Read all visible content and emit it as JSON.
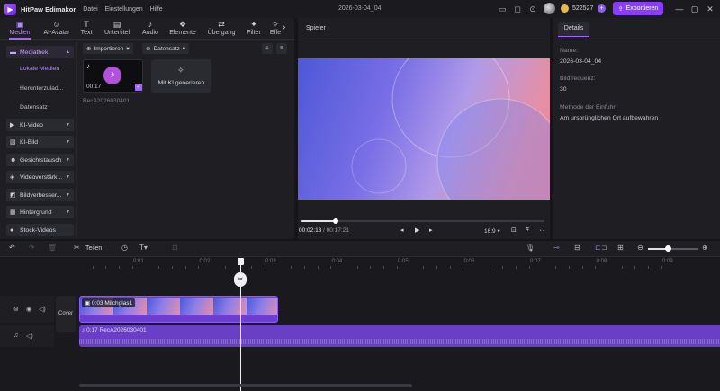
{
  "titlebar": {
    "app_name": "HitPaw Edimakor",
    "menu": [
      "Datei",
      "Einstellungen",
      "Hilfe"
    ],
    "project_title": "2026-03-04_04",
    "coins": "522527",
    "export_label": "Exportieren"
  },
  "tabs": [
    {
      "label": "Medien",
      "icon": "media-icon",
      "glyph": "▣"
    },
    {
      "label": "AI-Avatar",
      "icon": "avatar-icon",
      "glyph": "☺"
    },
    {
      "label": "Text",
      "icon": "text-icon",
      "glyph": "T"
    },
    {
      "label": "Untertitel",
      "icon": "subtitle-icon",
      "glyph": "▤"
    },
    {
      "label": "Audio",
      "icon": "audio-icon",
      "glyph": "♪"
    },
    {
      "label": "Elemente",
      "icon": "elements-icon",
      "glyph": "❖"
    },
    {
      "label": "Übergang",
      "icon": "transition-icon",
      "glyph": "⇄"
    },
    {
      "label": "Filter",
      "icon": "filter-icon",
      "glyph": "✦"
    },
    {
      "label": "Effe",
      "icon": "effects-icon",
      "glyph": "✧"
    }
  ],
  "sidebar": {
    "mediathek": "Mediathek",
    "sub_items": [
      "Lokale Medien",
      "Herunterzulad...",
      "Datensatz"
    ],
    "groups": [
      {
        "label": "KI-Video",
        "icon": "ai-video-icon",
        "glyph": "▶"
      },
      {
        "label": "KI-Bild",
        "icon": "ai-image-icon",
        "glyph": "▧"
      },
      {
        "label": "Gesichtstausch",
        "icon": "face-swap-icon",
        "glyph": "☻"
      },
      {
        "label": "Videoverstärk...",
        "icon": "video-enhance-icon",
        "glyph": "◈"
      },
      {
        "label": "Bildverbesser...",
        "icon": "image-enhance-icon",
        "glyph": "◩"
      },
      {
        "label": "Hintergrund",
        "icon": "background-icon",
        "glyph": "▦"
      },
      {
        "label": "Stock-Videos",
        "icon": "stock-video-icon",
        "glyph": "●"
      }
    ]
  },
  "media": {
    "import_label": "Importieren",
    "dataset_label": "Datensatz",
    "item_duration": "00:17",
    "item_name": "RecA2026030401",
    "ai_generate_label": "Mit KI generieren"
  },
  "player": {
    "title": "Spieler",
    "current_time": "00:02:13",
    "total_time": "/ 00:17:21",
    "progress": 0.14,
    "aspect": "16:9"
  },
  "details": {
    "tab_label": "Details",
    "fields": [
      {
        "label": "Name:",
        "value": "2026-03-04_04"
      },
      {
        "label": "Bildfrequenz:",
        "value": "30"
      },
      {
        "label": "Methode der Einfuhr:",
        "value": "Am ursprünglichen Ort aufbewahren"
      }
    ]
  },
  "timeline": {
    "split_label": "Teilen",
    "ruler_labels": [
      "0:01",
      "0:02",
      "0:03",
      "0:04",
      "0:05",
      "0:06",
      "0:07",
      "0:08",
      "0:09"
    ],
    "cover_label": "Cover",
    "video_clip_label": "0:03 Milchglas1",
    "audio_clip_label": "0:17 RecA2026030401",
    "zoom": 0.4
  }
}
